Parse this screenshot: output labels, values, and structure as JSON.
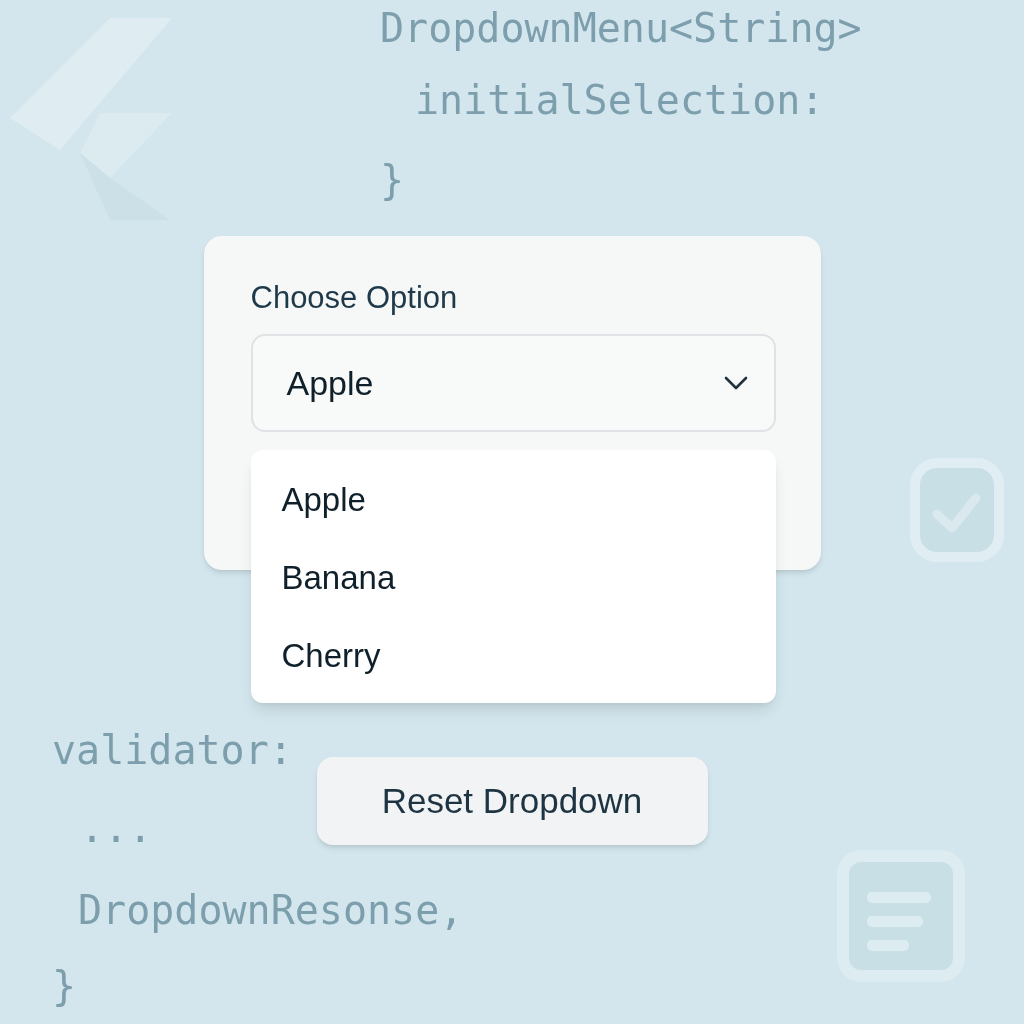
{
  "background_code": [
    {
      "text": "DropdownMenu<String>"
    },
    {
      "text": "initialSelection:"
    },
    {
      "text": "}"
    },
    {
      "text": "validator:"
    },
    {
      "text": "..."
    },
    {
      "text": "DropdownResonse,"
    },
    {
      "text": "}"
    }
  ],
  "card": {
    "label": "Choose Option",
    "select": {
      "value": "Apple",
      "expanded": true
    }
  },
  "menu": {
    "items": [
      {
        "label": "Apple"
      },
      {
        "label": "Banana"
      },
      {
        "label": "Cherry"
      }
    ]
  },
  "reset_button": {
    "label": "Reset Dropdown"
  }
}
